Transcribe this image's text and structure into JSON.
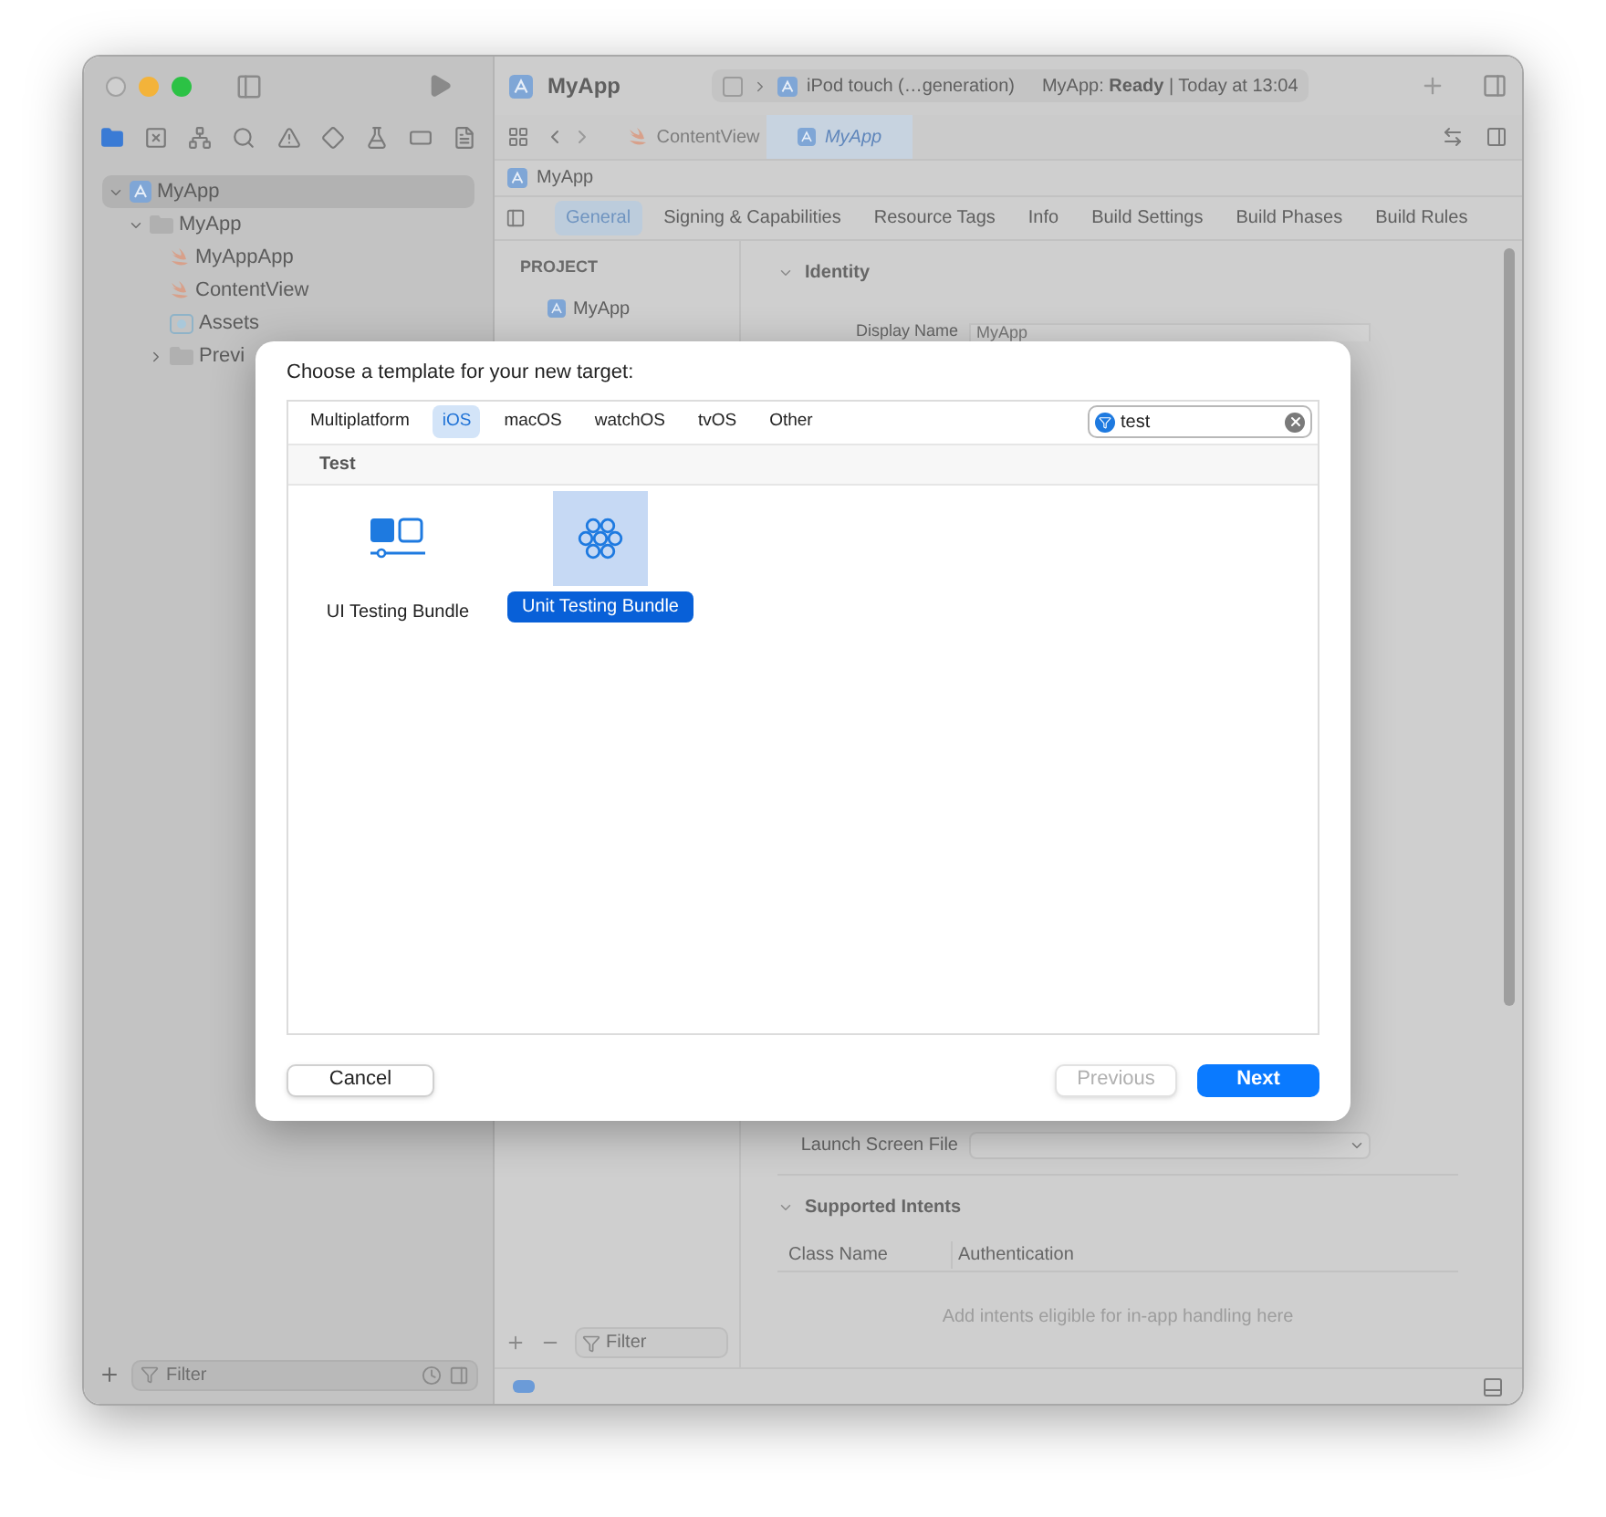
{
  "toolbar": {
    "project": "MyApp",
    "destination": "iPod touch (…generation)",
    "status": "MyApp: **Ready** | Today at 13:04"
  },
  "navigator": {
    "tree": [
      {
        "kind": "project",
        "label": "MyApp",
        "selected": true,
        "expanded": true,
        "children": [
          {
            "kind": "folder",
            "label": "MyApp",
            "selected": false,
            "expanded": true,
            "children": [
              {
                "kind": "swift",
                "label": "MyAppApp",
                "selected": false
              },
              {
                "kind": "swift",
                "label": "ContentView",
                "selected": false
              },
              {
                "kind": "assets",
                "label": "Assets",
                "selected": false
              },
              {
                "kind": "folder",
                "label": "Previ",
                "selected": false,
                "expanded": false
              }
            ]
          }
        ]
      }
    ],
    "filter_placeholder": "Filter"
  },
  "editor_tabs": [
    {
      "label": "ContentView",
      "selected": false
    },
    {
      "label": "MyApp",
      "selected": true
    }
  ],
  "breadcrumb": "MyApp",
  "settings_tabs": [
    {
      "label": "General",
      "selected": true
    },
    {
      "label": "Signing & Capabilities",
      "selected": false
    },
    {
      "label": "Resource Tags",
      "selected": false
    },
    {
      "label": "Info",
      "selected": false
    },
    {
      "label": "Build Settings",
      "selected": false
    },
    {
      "label": "Build Phases",
      "selected": false
    },
    {
      "label": "Build Rules",
      "selected": false
    }
  ],
  "project_list": {
    "header": "PROJECT",
    "items": [
      {
        "label": "MyApp"
      }
    ],
    "filter_placeholder": "Filter"
  },
  "identity": {
    "title": "Identity",
    "fields": [
      {
        "label": "Display Name",
        "value": "MyApp"
      }
    ]
  },
  "launch_screen": {
    "label": "Launch Screen File"
  },
  "supported_intents": {
    "title": "Supported Intents",
    "columns": [
      "Class Name",
      "Authentication"
    ],
    "empty_text": "Add intents eligible for in-app handling here"
  },
  "dialog": {
    "title": "Choose a template for your new target:",
    "platforms": [
      {
        "label": "Multiplatform",
        "selected": false
      },
      {
        "label": "iOS",
        "selected": true
      },
      {
        "label": "macOS",
        "selected": false
      },
      {
        "label": "watchOS",
        "selected": false
      },
      {
        "label": "tvOS",
        "selected": false
      },
      {
        "label": "Other",
        "selected": false
      }
    ],
    "search": {
      "value": "test"
    },
    "section": "Test",
    "templates": [
      {
        "kind": "ui",
        "label": "UI Testing Bundle",
        "selected": false
      },
      {
        "kind": "unit",
        "label": "Unit Testing Bundle",
        "selected": true
      }
    ],
    "buttons": [
      {
        "kind": "cancel",
        "label": "Cancel",
        "disabled": false
      },
      {
        "kind": "previous",
        "label": "Previous",
        "disabled": true
      },
      {
        "kind": "next",
        "label": "Next",
        "disabled": false
      }
    ]
  }
}
